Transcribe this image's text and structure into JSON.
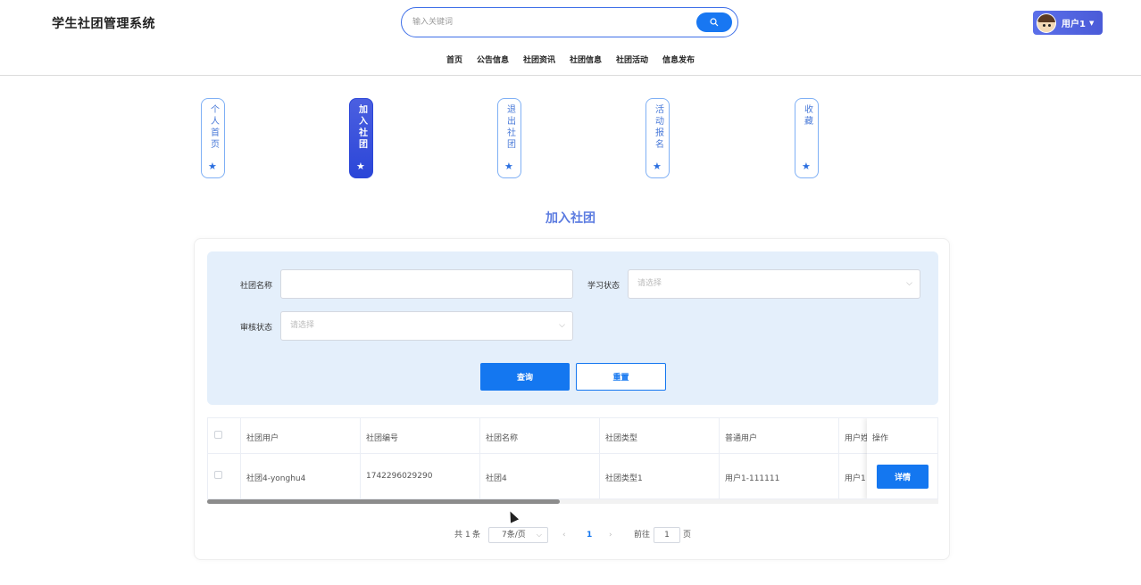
{
  "header": {
    "site_title": "学生社团管理系统",
    "search_placeholder": "输入关键词",
    "user_label": "用户1",
    "nav": [
      "首页",
      "公告信息",
      "社团资讯",
      "社团信息",
      "社团活动",
      "信息发布"
    ]
  },
  "side_tabs": [
    {
      "label": "个人首页",
      "active": false
    },
    {
      "label": "加入社团",
      "active": true
    },
    {
      "label": "退出社团",
      "active": false
    },
    {
      "label": "活动报名",
      "active": false
    },
    {
      "label": "收藏",
      "active": false
    }
  ],
  "page_title": "加入社团",
  "filter": {
    "club_name_label": "社团名称",
    "club_name_value": "",
    "study_status_label": "学习状态",
    "study_status_placeholder": "请选择",
    "audit_status_label": "审核状态",
    "audit_status_placeholder": "请选择",
    "query_label": "查询",
    "reset_label": "重置"
  },
  "table": {
    "headers": [
      "社团用户",
      "社团编号",
      "社团名称",
      "社团类型",
      "普通用户",
      "用户姓",
      "操作"
    ],
    "rows": [
      [
        "社团4-yonghu4",
        "1742296029290",
        "社团4",
        "社团类型1",
        "用户1-111111",
        "用户1"
      ]
    ],
    "detail_label": "详情"
  },
  "pagination": {
    "total_prefix": "共",
    "total": "1",
    "total_suffix": "条",
    "page_size": "7条/页",
    "current_page": "1",
    "goto_label": "前往",
    "goto_value": "1",
    "page_suffix": "页"
  },
  "colors": {
    "primary": "#1477f0",
    "active_tab": "#2b46d8",
    "heading": "#5b7be0",
    "filter_bg": "#e4effb"
  }
}
